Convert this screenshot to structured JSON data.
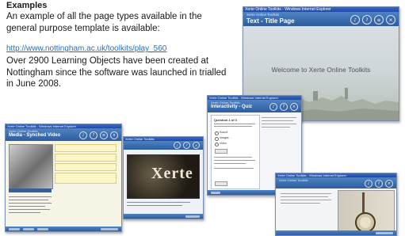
{
  "text_block": {
    "heading": "Examples",
    "intro": "An example of all the page types available in the general purpose template is available:",
    "link": "http://www.nottingham.ac.uk/toolkits/play_560",
    "stats": "Over 2900 Learning Objects have been created at Nottingham since the software was launched in trialled in June 2008."
  },
  "screens": {
    "main": {
      "window_title": "Xerte Online Toolkits - Windows Internet Explorer",
      "subtitle": "Xerte Online Toolkits",
      "title": "Text - Title Page",
      "welcome": "Welcome to Xerte Online Toolkits"
    },
    "video": {
      "window_title": "Xerte Online Toolkits - Windows Internet Explorer",
      "subtitle": "Xerte Online Toolkits",
      "title": "Media - Synched Video"
    },
    "xerte": {
      "window_title": "Xerte Online Toolkits",
      "logo_text": "Xerte"
    },
    "quiz": {
      "window_title": "Xerte Online Toolkits - Windows Internet Explorer",
      "subtitle": "Xerte Online Toolkits",
      "title": "Interactivity - Quiz",
      "question_header": "Question 1 of 3",
      "options": [
        "Sound",
        "Images",
        "Video"
      ]
    },
    "banjo": {
      "window_title": "Xerte Online Toolkits - Windows Internet Explorer",
      "subtitle": "Xerte Online Toolkits"
    }
  },
  "icons": [
    "speech-icon",
    "help-icon",
    "glossary-icon",
    "close-icon"
  ],
  "colors": {
    "header_blue": "#2d5d9e",
    "link_blue": "#1f6fbf",
    "highlight_yellow": "#fbf6c6"
  }
}
